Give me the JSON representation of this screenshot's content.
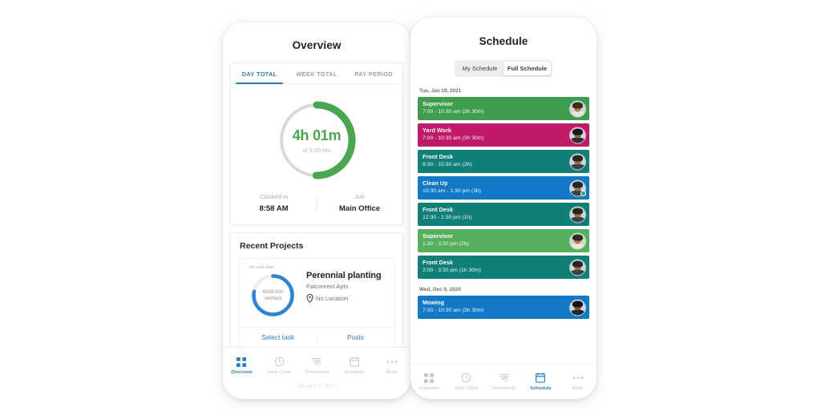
{
  "colors": {
    "accent_blue": "#2c7fc4",
    "green": "#4aa64f",
    "track_gray": "#d7dadd",
    "ring_blue": "#2b85d4",
    "shift_green": "#3e9e4e",
    "shift_green_light": "#55b05e",
    "shift_magenta": "#bf1b68",
    "shift_teal": "#0f7f77",
    "shift_blue": "#1279c9"
  },
  "overview": {
    "title": "Overview",
    "tabs": [
      {
        "label": "DAY TOTAL",
        "active": true
      },
      {
        "label": "WEEK TOTAL",
        "active": false
      },
      {
        "label": "PAY PERIOD",
        "active": false
      }
    ],
    "donut": {
      "value_label": "4h 01m",
      "goal_label": "of 8.00 hrs",
      "percent": 50.2,
      "hours_worked": 4.0167,
      "hours_goal": 8.0
    },
    "stats": [
      {
        "label": "Clocked in",
        "value": "8:58 AM"
      },
      {
        "label": "Job",
        "value": "Main Office"
      }
    ],
    "recent_projects": {
      "heading": "Recent Projects",
      "no_end_date": "No end date",
      "ring_value": "4928.50h",
      "ring_unit": "worked",
      "ring_percent": 78,
      "project_name": "Perennial planting",
      "project_client": "Falconrest Apts",
      "location": "No Location",
      "actions": [
        {
          "label": "Select task"
        },
        {
          "label": "Posts"
        }
      ]
    },
    "cut_off_text": "January 5, 2021"
  },
  "schedule": {
    "title": "Schedule",
    "segments": [
      {
        "label": "My Schedule",
        "selected": false
      },
      {
        "label": "Full Schedule",
        "selected": true
      }
    ],
    "days": [
      {
        "date_label": "Tue, Jan 19, 2021",
        "shifts": [
          {
            "name": "Supervisor",
            "time": "7:00 - 10:30 am (3h 30m)",
            "color": "#3e9e4e",
            "avatar": {
              "hair": "#3a2a1e",
              "skin": "#b5784c",
              "body": "#e8e5de"
            },
            "online": false
          },
          {
            "name": "Yard Work",
            "time": "7:00 - 10:30 am (3h 30m)",
            "color": "#bf1b68",
            "avatar": {
              "hair": "#17181b",
              "skin": "#8d5f3d",
              "body": "#2b2d31"
            },
            "online": false
          },
          {
            "name": "Front Desk",
            "time": "8:30 - 10:30 am (2h)",
            "color": "#0f7f77",
            "avatar": {
              "hair": "#2c2520",
              "skin": "#9a6a47",
              "body": "#3b4247"
            },
            "online": false
          },
          {
            "name": "Clean Up",
            "time": "10:30 am - 1:30 pm (3h)",
            "color": "#1279c9",
            "avatar": {
              "hair": "#2c2520",
              "skin": "#9a6a47",
              "body": "#3b4247"
            },
            "online": true
          },
          {
            "name": "Front Desk",
            "time": "12:30 - 1:30 pm (1h)",
            "color": "#0f7f77",
            "avatar": {
              "hair": "#2c2520",
              "skin": "#9a6a47",
              "body": "#3b4247"
            },
            "online": false
          },
          {
            "name": "Supervisor",
            "time": "1:30 - 3:30 pm (2h)",
            "color": "#55b05e",
            "avatar": {
              "hair": "#3a2a1e",
              "skin": "#b5784c",
              "body": "#e8e5de"
            },
            "online": false
          },
          {
            "name": "Front Desk",
            "time": "2:00 - 3:30 pm (1h 30m)",
            "color": "#0f7f77",
            "avatar": {
              "hair": "#2c2520",
              "skin": "#9a6a47",
              "body": "#3b4247"
            },
            "online": false
          }
        ]
      },
      {
        "date_label": "Wed, Dec 9, 2020",
        "shifts": [
          {
            "name": "Mowing",
            "time": "7:00 - 10:30 am (3h 30m)",
            "color": "#1279c9",
            "avatar": {
              "hair": "#141518",
              "skin": "#7d5334",
              "body": "#24262a"
            },
            "online": false
          }
        ]
      }
    ]
  },
  "tabbar": {
    "items": [
      {
        "label": "Overview",
        "icon": "grid-icon"
      },
      {
        "label": "Time Clock",
        "icon": "clock-icon"
      },
      {
        "label": "Timesheets",
        "icon": "timesheet-icon"
      },
      {
        "label": "Schedule",
        "icon": "calendar-icon"
      },
      {
        "label": "More",
        "icon": "ellipsis-icon"
      }
    ],
    "active_left": "Overview",
    "active_right": "Schedule"
  }
}
